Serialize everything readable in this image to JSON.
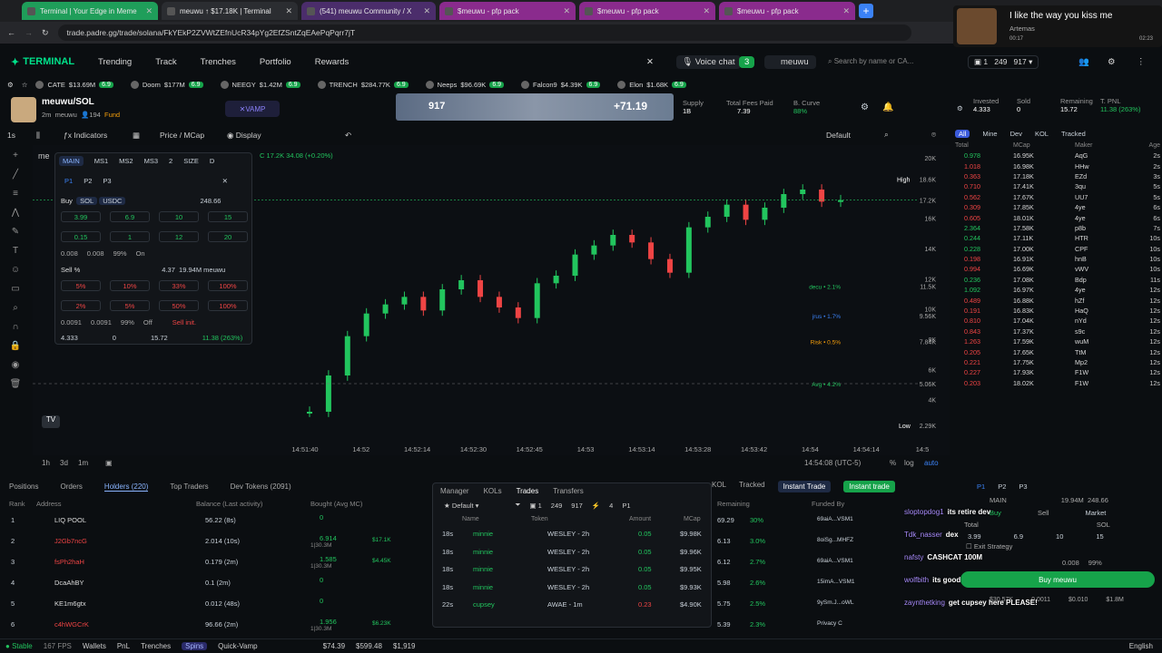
{
  "browser": {
    "tabs": [
      {
        "label": "Terminal | Your Edge in Meme",
        "color": "#1f9e5a"
      },
      {
        "label": "meuwu ↑ $17.18K | Terminal",
        "color": "#2b2d31"
      },
      {
        "label": "(541) meuwu Community / X",
        "color": "#4b2d6b"
      },
      {
        "label": "$meuwu - pfp pack",
        "color": "#8a2b8d"
      },
      {
        "label": "$meuwu - pfp pack",
        "color": "#8a2b8d"
      },
      {
        "label": "$meuwu - pfp pack",
        "color": "#8a2b8d"
      }
    ],
    "url": "trade.padre.gg/trade/solana/FkYEkP2ZVWtZEfnUcR34pYg2EfZSntZqEAePqPqrr7jT"
  },
  "video": {
    "title": "I like the way you kiss me",
    "artist": "Artemas",
    "elapsed": "00:17",
    "total": "02:23"
  },
  "nav": {
    "logo": "TERMINAL",
    "links": [
      "Trending",
      "Track",
      "Trenches",
      "Portfolio",
      "Rewards"
    ],
    "voice_chat": "Voice chat",
    "count_badge": "3",
    "token_name": "meuwu",
    "search_placeholder": "Search by name or CA...",
    "wallet_count": "1",
    "balance_a": "249",
    "balance_b": "917"
  },
  "ticker": [
    {
      "name": "CATE",
      "value": "$13.69M",
      "pct": "6.9"
    },
    {
      "name": "Doom",
      "value": "$177M",
      "pct": "6.9"
    },
    {
      "name": "NEEGY",
      "value": "$1.42M",
      "pct": "6.9"
    },
    {
      "name": "TRENCH",
      "value": "$284.77K",
      "pct": "6.9"
    },
    {
      "name": "Neeps",
      "value": "$96.69K",
      "pct": "6.9"
    },
    {
      "name": "Falcon9",
      "value": "$4.39K",
      "pct": "6.9"
    },
    {
      "name": "Elon",
      "value": "$1.68K",
      "pct": "6.9"
    }
  ],
  "token": {
    "pair": "meuwu/SOL",
    "age": "2m",
    "ticker": "meuwu",
    "holders": "194",
    "fund": "Fund",
    "vamp": "VAMP",
    "banner_value": "917",
    "banner_pct": "+71.19",
    "supply_label": "Supply",
    "supply": "1B",
    "fees_label": "Total Fees Paid",
    "fees": "7.39",
    "curve_label": "B. Curve",
    "curve": "88%",
    "invested_label": "Invested",
    "invested": "4.333",
    "sold_label": "Sold",
    "sold": "0",
    "remaining_label": "Remaining",
    "remaining": "15.72",
    "tpnl_label": "T. PNL",
    "tpnl": "11.38 (263%)"
  },
  "toolbar": {
    "interval": "1s",
    "indicators": "Indicators",
    "price_mcap": "Price / MCap",
    "display": "Display",
    "default_layout": "Default"
  },
  "chart": {
    "ohlc_label": "C 17.2K 34.08 (+0.20%)",
    "chart_data": {
      "type": "line",
      "title": "",
      "x": [
        "14:51:40",
        "14:52",
        "14:52:14",
        "14:52:30",
        "14:52:45",
        "14:53",
        "14:53:14",
        "14:53:28",
        "14:53:42",
        "14:54",
        "14:54:14",
        "14:5"
      ],
      "ylim": [
        2000,
        20000
      ],
      "yticks": [
        "20K",
        "18.6K",
        "17.2K",
        "16K",
        "14K",
        "12K",
        "11.5K",
        "10K",
        "9.56K",
        "8K",
        "7.84K",
        "6K",
        "5.06K",
        "4K",
        "2.29K"
      ],
      "series": [
        {
          "name": "",
          "values": [
            3200,
            5600,
            8200,
            9700,
            10300,
            10800,
            9900,
            11300,
            11900,
            10800,
            10100,
            9400,
            11700,
            12200,
            13600,
            14200,
            14900,
            14400,
            13300,
            12400,
            15400,
            16100,
            16900,
            15900,
            16700,
            17600,
            17900,
            17100,
            17200
          ]
        }
      ],
      "high_label": "High",
      "high_value": "18.6K",
      "low_label": "Low",
      "low_value": "2.29K",
      "levels": [
        {
          "label": "decu • 2.1%",
          "value": "11.5K"
        },
        {
          "label": "jrus • 1.7%",
          "value": "9.56K"
        },
        {
          "label": "Risk • 0.5%",
          "value": "7.84K"
        },
        {
          "label": "Avg • 4.2%",
          "value": "5.06K"
        }
      ]
    },
    "timeframes": [
      "1h",
      "3d",
      "1m"
    ],
    "clock": "14:54:08 (UTC-5)",
    "scale_opts": [
      "%",
      "log",
      "auto"
    ]
  },
  "order": {
    "tabs": [
      "MAIN",
      "MS1",
      "MS2",
      "MS3",
      "2",
      "SIZE",
      "D"
    ],
    "presets": [
      "P1",
      "P2",
      "P3"
    ],
    "buy_label": "Buy",
    "sol": "SOL",
    "usdc": "USDC",
    "buy_balance": "248.66",
    "buy_amounts": [
      "3.99",
      "6.9",
      "10",
      "15",
      "0.15",
      "1",
      "12",
      "20"
    ],
    "buy_fee": "0.008",
    "buy_fee2": "0.008",
    "buy_slip": "99%",
    "buy_mev": "On",
    "sell_label": "Sell %",
    "sell_info": "4.37",
    "sell_mcap": "19.94M meuwu",
    "sell_pcts": [
      "5%",
      "10%",
      "33%",
      "100%",
      "2%",
      "5%",
      "50%",
      "100%"
    ],
    "sell_fee": "0.0091",
    "sell_fee2": "0.0091",
    "sell_slip": "99%",
    "sell_mev": "Off",
    "sell_init": "Sell init.",
    "pnl": [
      "4.333",
      "0",
      "15.72",
      "11.38 (263%)"
    ]
  },
  "tradeslist": {
    "filters": [
      "All",
      "Mine",
      "Dev",
      "KOL",
      "Tracked"
    ],
    "headers": [
      "Total",
      "MCap",
      "Maker",
      "Age"
    ],
    "rows": [
      {
        "total": "0.978",
        "mcap": "16.95K",
        "maker": "AqG",
        "age": "2s",
        "side": "g"
      },
      {
        "total": "1.018",
        "mcap": "16.98K",
        "maker": "HHw",
        "age": "2s",
        "side": "r"
      },
      {
        "total": "0.363",
        "mcap": "17.18K",
        "maker": "EZd",
        "age": "3s",
        "side": "r"
      },
      {
        "total": "0.710",
        "mcap": "17.41K",
        "maker": "3qu",
        "age": "5s",
        "side": "r"
      },
      {
        "total": "0.562",
        "mcap": "17.67K",
        "maker": "UU7",
        "age": "5s",
        "side": "r"
      },
      {
        "total": "0.309",
        "mcap": "17.85K",
        "maker": "4ye",
        "age": "6s",
        "side": "r"
      },
      {
        "total": "0.605",
        "mcap": "18.01K",
        "maker": "4ye",
        "age": "6s",
        "side": "r"
      },
      {
        "total": "2.364",
        "mcap": "17.58K",
        "maker": "p8b",
        "age": "7s",
        "side": "g"
      },
      {
        "total": "0.244",
        "mcap": "17.11K",
        "maker": "HTR",
        "age": "10s",
        "side": "g"
      },
      {
        "total": "0.228",
        "mcap": "17.00K",
        "maker": "CPF",
        "age": "10s",
        "side": "g"
      },
      {
        "total": "0.198",
        "mcap": "16.91K",
        "maker": "hnB",
        "age": "10s",
        "side": "r"
      },
      {
        "total": "0.994",
        "mcap": "16.69K",
        "maker": "vWV",
        "age": "10s",
        "side": "r"
      },
      {
        "total": "0.236",
        "mcap": "17.08K",
        "maker": "Bdp",
        "age": "11s",
        "side": "g"
      },
      {
        "total": "1.092",
        "mcap": "16.97K",
        "maker": "4ye",
        "age": "12s",
        "side": "g"
      },
      {
        "total": "0.489",
        "mcap": "16.88K",
        "maker": "hZf",
        "age": "12s",
        "side": "r"
      },
      {
        "total": "0.191",
        "mcap": "16.83K",
        "maker": "HaQ",
        "age": "12s",
        "side": "r"
      },
      {
        "total": "0.810",
        "mcap": "17.04K",
        "maker": "nYd",
        "age": "12s",
        "side": "r"
      },
      {
        "total": "0.843",
        "mcap": "17.37K",
        "maker": "s9c",
        "age": "12s",
        "side": "r"
      },
      {
        "total": "1.263",
        "mcap": "17.59K",
        "maker": "wuM",
        "age": "12s",
        "side": "r"
      },
      {
        "total": "0.205",
        "mcap": "17.65K",
        "maker": "TtM",
        "age": "12s",
        "side": "r"
      },
      {
        "total": "0.221",
        "mcap": "17.75K",
        "maker": "Mp2",
        "age": "12s",
        "side": "r"
      },
      {
        "total": "0.227",
        "mcap": "17.93K",
        "maker": "F1W",
        "age": "12s",
        "side": "r"
      },
      {
        "total": "0.203",
        "mcap": "18.02K",
        "maker": "F1W",
        "age": "12s",
        "side": "r"
      }
    ]
  },
  "bottom": {
    "tabs": [
      "Positions",
      "Orders",
      "Holders (220)",
      "Top Traders",
      "Dev Tokens (2091)"
    ],
    "extra_tabs": [
      "KOL",
      "Tracked"
    ],
    "instant_trade": "Instant Trade",
    "instant_trade2": "Instant trade",
    "headers": [
      "Rank",
      "Address",
      "Balance (Last activity)",
      "Bought (Avg MC)",
      "Remaining",
      "Funded By"
    ],
    "holders": [
      {
        "rank": "1",
        "addr": "LIQ POOL",
        "bal": "56.22 (8s)",
        "bought": "0",
        "sub": "",
        "usd": "",
        "rem": "69.29",
        "pct": "30%",
        "funded": "69aiA...VSM1"
      },
      {
        "rank": "2",
        "addr": "J2Gb7ncG",
        "bal": "2.014 (10s)",
        "bought": "6.914",
        "sub": "1|30.3M",
        "usd": "$17.1K",
        "rem": "6.13",
        "pct": "3.0%",
        "funded": "8oiSg...MHFZ"
      },
      {
        "rank": "3",
        "addr": "fsPh2haH",
        "bal": "0.179 (2m)",
        "bought": "1.585",
        "sub": "1|30.3M",
        "usd": "$4.45K",
        "rem": "6.12",
        "pct": "2.7%",
        "funded": "69aiA...VSM1"
      },
      {
        "rank": "4",
        "addr": "DcaAhBY",
        "bal": "0.1 (2m)",
        "bought": "0",
        "sub": "",
        "usd": "",
        "rem": "5.98",
        "pct": "2.6%",
        "funded": "15imA...VSM1"
      },
      {
        "rank": "5",
        "addr": "KE1m6gtx",
        "bal": "0.012 (48s)",
        "bought": "0",
        "sub": "",
        "usd": "",
        "rem": "5.75",
        "pct": "2.5%",
        "funded": "9ySm.J...oWL"
      },
      {
        "rank": "6",
        "addr": "c4hWGCrK",
        "bal": "96.66 (2m)",
        "bought": "1.956",
        "sub": "1|30.3M",
        "usd": "$6.23K",
        "rem": "5.39",
        "pct": "2.3%",
        "funded": "Privacy C"
      }
    ]
  },
  "tradespanel": {
    "tabs": [
      "Manager",
      "KOLs",
      "Trades",
      "Transfers"
    ],
    "preset": "Default",
    "wallets": "1",
    "bal_a": "249",
    "bal_b": "917",
    "count": "4",
    "p": "P1",
    "headers": [
      "Name",
      "Token",
      "Amount",
      "MCap"
    ],
    "rows": [
      {
        "age": "18s",
        "name": "minnie",
        "token": "WESLEY - 2h",
        "amount": "0.05",
        "mcap": "$9.98K"
      },
      {
        "age": "18s",
        "name": "minnie",
        "token": "WESLEY - 2h",
        "amount": "0.05",
        "mcap": "$9.96K"
      },
      {
        "age": "18s",
        "name": "minnie",
        "token": "WESLEY - 2h",
        "amount": "0.05",
        "mcap": "$9.95K"
      },
      {
        "age": "18s",
        "name": "minnie",
        "token": "WESLEY - 2h",
        "amount": "0.05",
        "mcap": "$9.93K"
      },
      {
        "age": "22s",
        "name": "cupsey",
        "token": "AWAE - 1m",
        "amount": "0.23",
        "mcap": "$4.90K"
      }
    ]
  },
  "chat": [
    {
      "user": "sloptopdog1",
      "msg": "its retire dev"
    },
    {
      "user": "Tdk_nasser",
      "msg": "dex"
    },
    {
      "user": "nafsty",
      "msg": "CASHCAT 100M"
    },
    {
      "user": "wolfbith",
      "msg": "its good"
    },
    {
      "user": "zaynthetking",
      "msg": "get cupsey here PLEASE!"
    }
  ],
  "sidepanel": {
    "presets": [
      "P1",
      "P2",
      "P3"
    ],
    "main": "MAIN",
    "bal1": "19.94M",
    "bal2": "248.66",
    "buy": "Buy",
    "sell": "Sell",
    "market": "Market",
    "total": "Total",
    "sol": "SOL",
    "amounts": [
      "3.99",
      "6.9",
      "10",
      "15"
    ],
    "exit_strategy": "Exit Strategy",
    "fee1": "0.008",
    "slip": "99%",
    "buy_button": "Buy meuwu",
    "stats": [
      "$30.57K",
      "0.0011",
      "$0.010",
      "$1.8M"
    ]
  },
  "status": {
    "stable": "Stable",
    "fps": "167 FPS",
    "items": [
      "Wallets",
      "PnL",
      "Trenches",
      "Spins",
      "Quick-Vamp"
    ],
    "prices": [
      "$74.39",
      "$599.48",
      "$1,919"
    ],
    "lang": "English"
  }
}
